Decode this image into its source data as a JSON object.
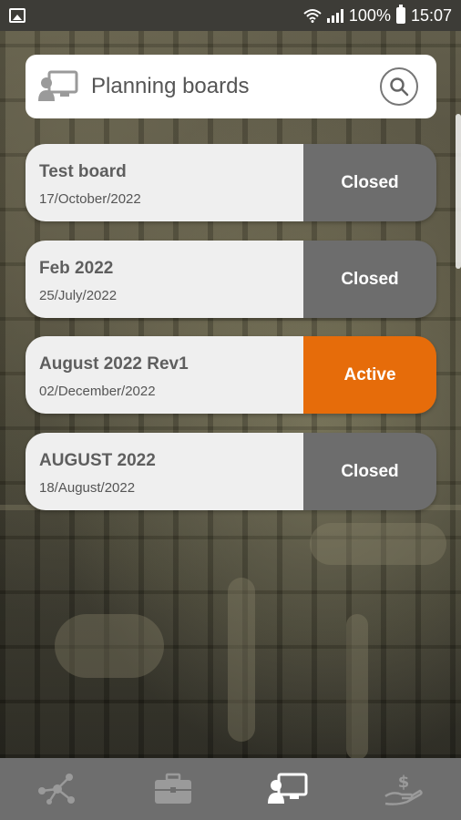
{
  "status_bar": {
    "battery": "100%",
    "time": "15:07"
  },
  "header": {
    "title": "Planning boards",
    "icon": "planning-board-icon",
    "search_icon": "search-icon"
  },
  "boards": [
    {
      "name": "Test board",
      "date": "17/October/2022",
      "status": "Closed"
    },
    {
      "name": "Feb 2022",
      "date": "25/July/2022",
      "status": "Closed"
    },
    {
      "name": "August 2022 Rev1",
      "date": "02/December/2022",
      "status": "Active"
    },
    {
      "name": "AUGUST 2022",
      "date": "18/August/2022",
      "status": "Closed"
    }
  ],
  "bottom_nav": [
    {
      "icon": "network-icon"
    },
    {
      "icon": "briefcase-icon"
    },
    {
      "icon": "planning-board-icon",
      "selected": true
    },
    {
      "icon": "money-hand-icon"
    }
  ],
  "colors": {
    "active": "#e66c0a",
    "closed": "#6d6d6d",
    "nav_bg": "#6e6e6e"
  }
}
